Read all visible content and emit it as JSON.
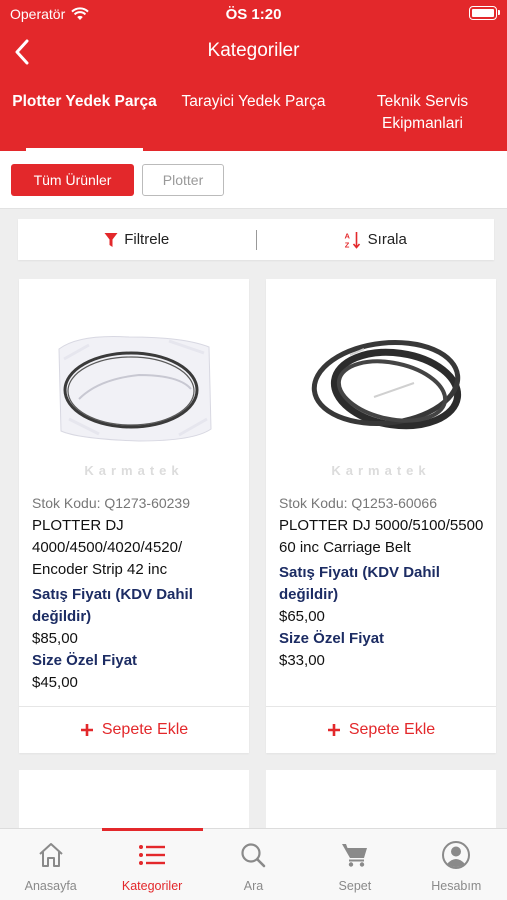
{
  "status_bar": {
    "carrier": "Operatör",
    "time": "ÖS 1:20"
  },
  "nav": {
    "title": "Kategoriler"
  },
  "category_tabs": [
    {
      "label": "Plotter Yedek Parça",
      "active": true
    },
    {
      "label": "Tarayici Yedek Parça",
      "active": false
    },
    {
      "label": "Teknik Servis Ekipmanlari",
      "active": false
    }
  ],
  "filters": {
    "all_products": "Tüm Ürünler",
    "plotter": "Plotter"
  },
  "toolbar": {
    "filter_label": "Filtrele",
    "sort_label": "Sırala"
  },
  "products": [
    {
      "watermark": "Karmatek",
      "stock_code": "Stok Kodu: Q1273-60239",
      "name": "PLOTTER DJ 4000/4500/4020/4520/ Encoder Strip 42 inc",
      "sale_label": "Satış Fiyatı (KDV Dahil değildir)",
      "sale_price": "$85,00",
      "special_label": "Size Özel Fiyat",
      "special_price": "$45,00",
      "add_to_cart": "Sepete Ekle"
    },
    {
      "watermark": "Karmatek",
      "stock_code": "Stok Kodu: Q1253-60066",
      "name": "PLOTTER DJ 5000/5100/5500 60 inc Carriage Belt",
      "sale_label": "Satış Fiyatı (KDV Dahil değildir)",
      "sale_price": "$65,00",
      "special_label": "Size Özel Fiyat",
      "special_price": "$33,00",
      "add_to_cart": "Sepete Ekle"
    }
  ],
  "tabbar": [
    {
      "label": "Anasayfa",
      "icon": "home-icon",
      "active": false
    },
    {
      "label": "Kategoriler",
      "icon": "list-icon",
      "active": true
    },
    {
      "label": "Ara",
      "icon": "search-icon",
      "active": false
    },
    {
      "label": "Sepet",
      "icon": "cart-icon",
      "active": false
    },
    {
      "label": "Hesabım",
      "icon": "account-icon",
      "active": false
    }
  ],
  "colors": {
    "brand_red": "#e3282b",
    "price_label_navy": "#1c2c63",
    "tab_inactive": "#8a8a8a"
  }
}
